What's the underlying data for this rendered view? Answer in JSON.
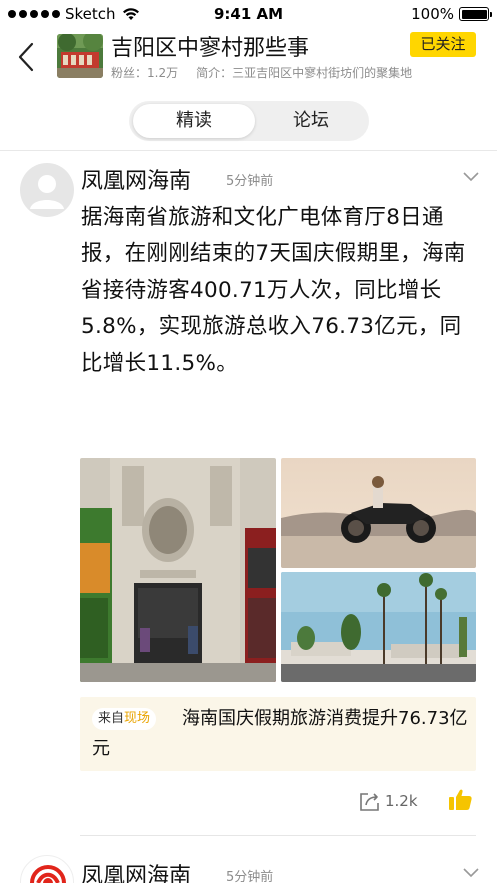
{
  "status_bar": {
    "carrier": "Sketch",
    "time": "9:41 AM",
    "battery": "100%"
  },
  "header": {
    "title": "吉阳区中寥村那些事",
    "fans": "粉丝：1.2万",
    "intro": "简介：三亚吉阳区中寥村街坊们的聚集地",
    "follow_label": "已关注"
  },
  "tabs": [
    {
      "label": "精读",
      "active": true
    },
    {
      "label": "论坛",
      "active": false
    }
  ],
  "post": {
    "author": "凤凰网海南",
    "time": "5分钟前",
    "text": "据海南省旅游和文化广电体育厅8日通报，在刚刚结束的7天国庆假期里，海南省接待游客400.71万人次，同比增长5.8%，实现旅游总收入76.73亿元，同比增长11.5%。",
    "source_prefix": "来自",
    "source_name": "现场",
    "source_title": "海南国庆假期旅游消费提升76.73亿元",
    "share_count": "1.2k"
  },
  "post2": {
    "author": "凤凰网海南",
    "time": "5分钟前"
  },
  "colors": {
    "accent": "#ffd600",
    "source_bg": "#fbf6e8",
    "source_highlight": "#e9a400",
    "like": "#f5c400"
  }
}
